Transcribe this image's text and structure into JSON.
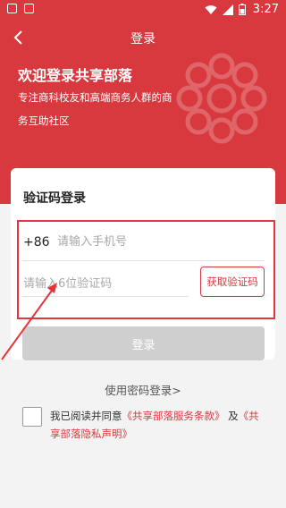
{
  "status_bar": {
    "time": "3:27"
  },
  "navbar": {
    "title": "登录"
  },
  "hero": {
    "welcome": "欢迎登录共享部落",
    "subtitle": "专注商科校友和高端商务人群的商务互助社区"
  },
  "card": {
    "title": "验证码登录"
  },
  "phone": {
    "country_code": "+86",
    "placeholder": "请输入手机号"
  },
  "code": {
    "placeholder": "请输入6位验证码",
    "get_code_label": "获取验证码"
  },
  "login_button": {
    "label": "登录"
  },
  "password_login_link": "使用密码登录>",
  "agreement": {
    "prefix": "我已阅读并同意",
    "terms_link": "《共享部落服务条款》",
    "conjunction": "及",
    "privacy_link": "《共享部落隐私声明》"
  },
  "colors": {
    "brand_red": "#d8393f",
    "disabled_button": "#cfcfcf",
    "background": "#f3f3f3"
  }
}
